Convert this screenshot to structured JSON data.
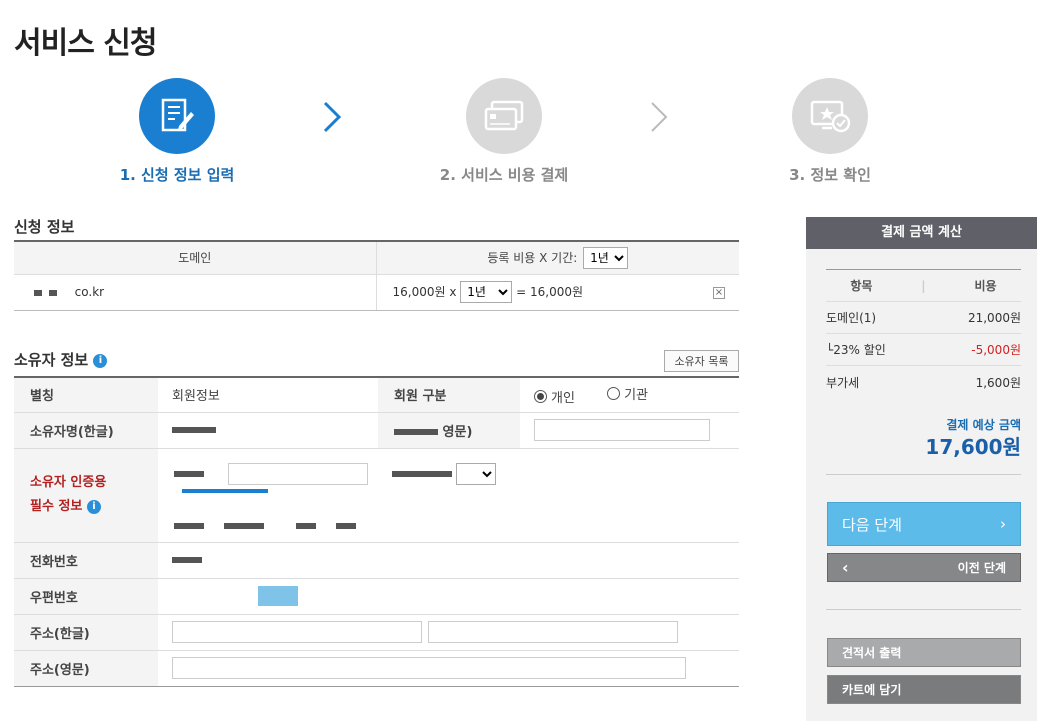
{
  "page": {
    "title": "서비스 신청"
  },
  "steps": [
    {
      "label": "1. 신청 정보 입력"
    },
    {
      "label": "2. 서비스 비용 결제"
    },
    {
      "label": "3. 정보 확인"
    }
  ],
  "apply": {
    "section_title": "신청 정보",
    "col_domain": "도메인",
    "col_fee": "등록 비용 X 기간:",
    "period_header": "1년",
    "row": {
      "domain_suffix": "co.kr",
      "unit_price": "16,000원 x",
      "period": "1년",
      "total": "= 16,000원"
    }
  },
  "owner": {
    "section_title": "소유자 정보",
    "list_button": "소유자 목록",
    "rows": {
      "nickname_label": "별칭",
      "nickname_value": "회원정보",
      "member_type_label": "회원 구분",
      "member_type_personal": "개인",
      "member_type_org": "기관",
      "name_ko_label": "소유자명(한글)",
      "name_en_label_suffix": "영문)",
      "cert_label_1": "소유자 인증용",
      "cert_label_2": "필수 정보",
      "phone_label": "전화번호",
      "zip_label": "우편번호",
      "addr_ko_label": "주소(한글)",
      "addr_en_label": "주소(영문)"
    }
  },
  "sidebar": {
    "title": "결제 금액 계산",
    "col_item": "항목",
    "col_cost": "비용",
    "items": [
      {
        "name": "도메인(1)",
        "cost": "21,000원"
      },
      {
        "name": "└23% 할인",
        "cost": "-5,000원"
      },
      {
        "name": "부가세",
        "cost": "1,600원"
      }
    ],
    "total_label": "결제 예상 금액",
    "total_value": "17,600원",
    "next_button": "다음 단계",
    "prev_button": "이전 단계",
    "quote_button": "견적서 출력",
    "cart_button": "카트에 담기"
  },
  "colors": {
    "accent": "#1a7fd1",
    "discount": "#d22222",
    "required": "#b22222"
  }
}
